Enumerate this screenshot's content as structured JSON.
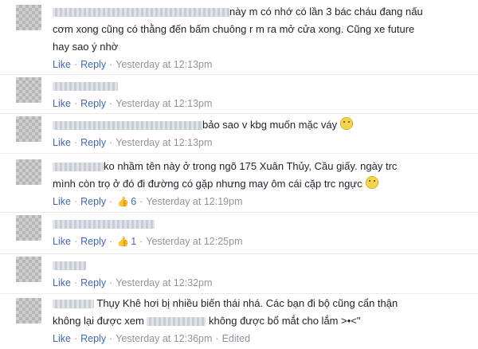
{
  "actions": {
    "like": "Like",
    "reply": "Reply",
    "dot": "·",
    "edited": "Edited"
  },
  "comments": [
    {
      "lines": [
        "này m có nhớ có lần 3 bác cháu đang nấu",
        "cơm xong cũng có thằng đến bấm chuông r m ra mở cửa xong. Cũng xe future",
        "hay sao ý nhờ"
      ],
      "time": "Yesterday at 12:13pm"
    },
    {
      "lines": [
        ""
      ],
      "time": "Yesterday at 12:13pm"
    },
    {
      "lines": [
        "bảo sao v kbg muốn mặc váy"
      ],
      "emoji": "sad-emoji",
      "time": "Yesterday at 12:13pm"
    },
    {
      "lines": [
        "ko nhầm tên này ở trong ngõ 175 Xuân Thủy, Cầu giấy. ngày trc",
        "mình còn trọ ở đó đi đường có gặp nhưng may ôm cái cặp trc ngực"
      ],
      "emoji": "grin-emoji",
      "likes": "6",
      "time": "Yesterday at 12:19pm"
    },
    {
      "lines": [
        ""
      ],
      "likes": "1",
      "time": "Yesterday at 12:25pm"
    },
    {
      "lines": [
        ""
      ],
      "time": "Yesterday at 12:32pm"
    },
    {
      "lines": [
        "Thụy Khê hơi bị nhiều biến thái nhá. Các bạn đi bộ cũng cẩn thận",
        "không lại được xem",
        "không được bổ mắt cho lắm >•<\""
      ],
      "time": "Yesterday at 12:36pm",
      "edited": true
    }
  ]
}
